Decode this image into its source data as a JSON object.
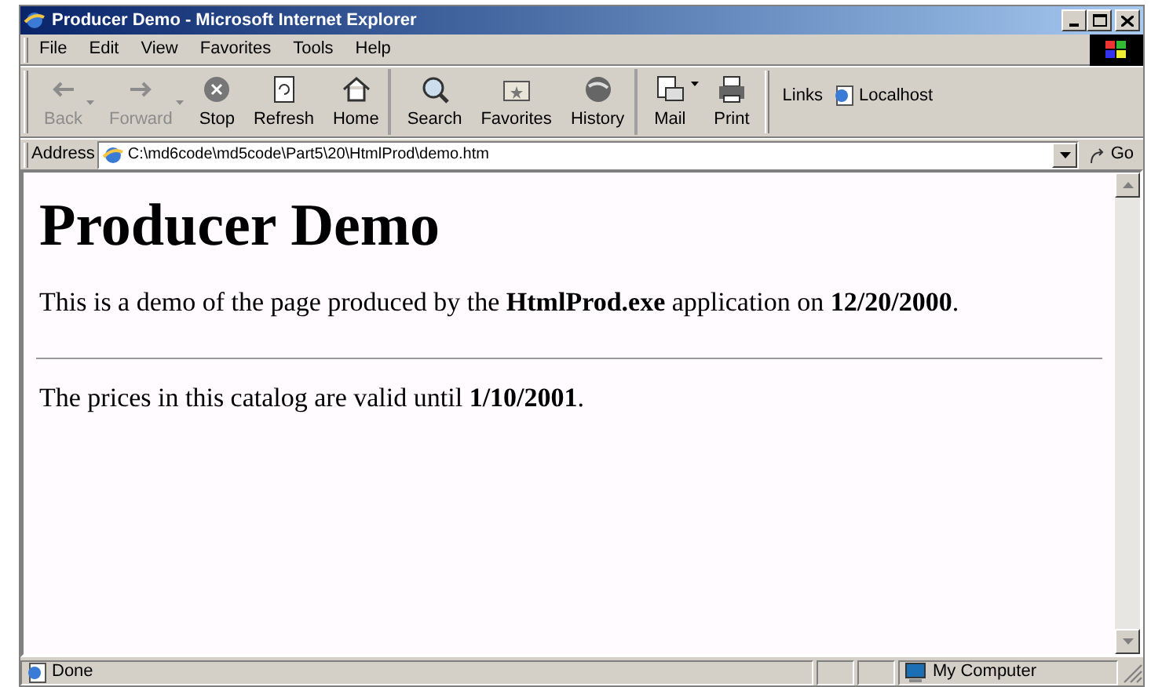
{
  "window": {
    "title": "Producer Demo - Microsoft Internet Explorer"
  },
  "menu": [
    "File",
    "Edit",
    "View",
    "Favorites",
    "Tools",
    "Help"
  ],
  "toolbar": [
    {
      "label": "Back",
      "kind": "back",
      "disabled": true,
      "dropdown": true
    },
    {
      "label": "Forward",
      "kind": "forward",
      "disabled": true,
      "dropdown": true
    },
    {
      "label": "Stop",
      "kind": "stop",
      "disabled": false,
      "dropdown": false
    },
    {
      "label": "Refresh",
      "kind": "refresh",
      "disabled": false,
      "dropdown": false
    },
    {
      "label": "Home",
      "kind": "home",
      "disabled": false,
      "dropdown": false,
      "separator_after": true
    },
    {
      "label": "Search",
      "kind": "search",
      "disabled": false,
      "dropdown": false
    },
    {
      "label": "Favorites",
      "kind": "favorites",
      "disabled": false,
      "dropdown": false
    },
    {
      "label": "History",
      "kind": "history",
      "disabled": false,
      "dropdown": false,
      "separator_after": true
    },
    {
      "label": "Mail",
      "kind": "mail",
      "disabled": false,
      "dropdown": true
    },
    {
      "label": "Print",
      "kind": "print",
      "disabled": false,
      "dropdown": false
    }
  ],
  "links": {
    "label": "Links",
    "items": [
      "Localhost"
    ]
  },
  "address": {
    "label": "Address",
    "value": "C:\\md6code\\md5code\\Part5\\20\\HtmlProd\\demo.htm",
    "go": "Go"
  },
  "page": {
    "heading": "Producer Demo",
    "paragraphs": [
      {
        "text": "This is a demo of the page produced by the **HtmlProd.exe** application on **12/20/2000**.",
        "rule_after": true
      },
      {
        "text": "The prices in this catalog are valid until **1/10/2001**.",
        "rule_after": false
      }
    ]
  },
  "status_bar": {
    "text": "Done",
    "zone": "My Computer"
  }
}
